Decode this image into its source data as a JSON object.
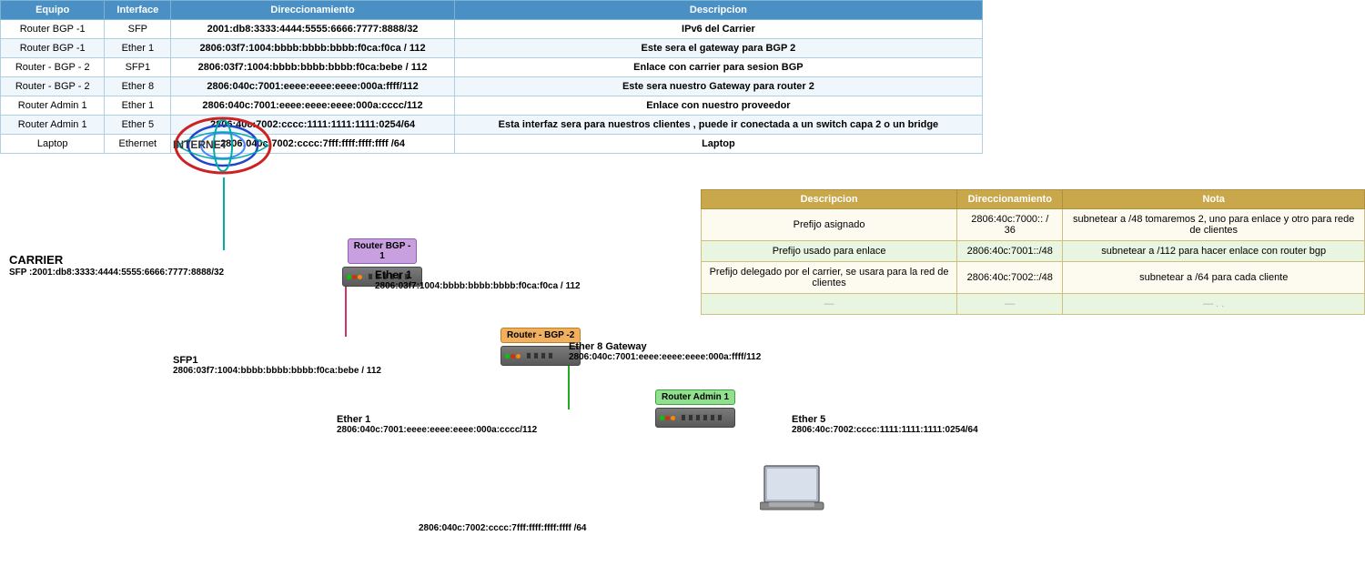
{
  "table": {
    "headers": [
      "Equipo",
      "Interface",
      "Direccionamiento",
      "Descripcion"
    ],
    "rows": [
      {
        "equipo": "Router BGP -1",
        "interface": "SFP",
        "direccionamiento": "2001:db8:3333:4444:5555:6666:7777:8888/32",
        "descripcion": "IPv6 del Carrier"
      },
      {
        "equipo": "Router BGP -1",
        "interface": "Ether 1",
        "direccionamiento": "2806:03f7:1004:bbbb:bbbb:bbbb:f0ca:f0ca / 112",
        "descripcion": "Este sera el gateway para BGP 2"
      },
      {
        "equipo": "Router - BGP - 2",
        "interface": "SFP1",
        "direccionamiento": "2806:03f7:1004:bbbb:bbbb:bbbb:f0ca:bebe / 112",
        "descripcion": "Enlace con carrier para sesion BGP"
      },
      {
        "equipo": "Router - BGP - 2",
        "interface": "Ether 8",
        "direccionamiento": "2806:040c:7001:eeee:eeee:eeee:000a:ffff/112",
        "descripcion": "Este sera nuestro Gateway para router 2"
      },
      {
        "equipo": "Router Admin 1",
        "interface": "Ether 1",
        "direccionamiento": "2806:040c:7001:eeee:eeee:eeee:000a:cccc/112",
        "descripcion": "Enlace con nuestro proveedor"
      },
      {
        "equipo": "Router Admin 1",
        "interface": "Ether 5",
        "direccionamiento": "2806:40c:7002:cccc:1111:1111:1111:0254/64",
        "descripcion": "Esta interfaz sera para nuestros clientes , puede ir conectada a un switch capa 2 o un bridge"
      },
      {
        "equipo": "Laptop",
        "interface": "Ethernet",
        "direccionamiento": "2806:040c:7002:cccc:7fff:ffff:ffff:ffff /64",
        "descripcion": "Laptop"
      }
    ]
  },
  "second_table": {
    "headers": [
      "Descripcion",
      "Direccionamiento",
      "Nota"
    ],
    "rows": [
      {
        "descripcion": "Prefijo asignado",
        "direccionamiento": "2806:40c:7000:: / 36",
        "nota": "subnetear a /48  tomaremos 2, uno para enlace y otro para rede de clientes"
      },
      {
        "descripcion": "Prefijo usado para enlace",
        "direccionamiento": "2806:40c:7001::/48",
        "nota": "subnetear a /112 para hacer enlace con router bgp"
      },
      {
        "descripcion": "Prefijo delegado por el carrier, se usara para la red de clientes",
        "direccionamiento": "2806:40c:7002::/48",
        "nota": "subnetear a /64 para cada cliente"
      },
      {
        "descripcion": "—",
        "direccionamiento": "—",
        "nota": "— . ."
      }
    ]
  },
  "diagram": {
    "internet_label": "INTERNET",
    "carrier_label": "CARRIER",
    "carrier_sfp": "SFP :2001:db8:3333:4444:5555:6666:7777:8888/32",
    "router_bgp1_label": "Router BGP -\n1",
    "router_bgp2_label": "Router - BGP -2",
    "router_admin1_label": "Router Admin 1",
    "ether1_bgp1_iface": "Ether 1",
    "ether1_bgp1_addr": "2806:03f7:1004:bbbb:bbbb:bbbb:f0ca:f0ca / 112",
    "sfp1_bgp2_iface": "SFP1",
    "sfp1_bgp2_addr": "2806:03f7:1004:bbbb:bbbb:bbbb:f0ca:bebe / 112",
    "ether8_gw_iface": "Ether 8 Gateway",
    "ether8_gw_addr": "2806:040c:7001:eeee:eeee:eeee:000a:ffff/112",
    "ether1_admin_iface": "Ether 1",
    "ether1_admin_addr": "2806:040c:7001:eeee:eeee:eeee:000a:cccc/112",
    "ether5_admin_iface": "Ether 5",
    "ether5_admin_addr": "2806:40c:7002:cccc:1111:1111:1111:0254/64",
    "laptop_addr": "2806:040c:7002:cccc:7fff:ffff:ffff:ffff /64"
  }
}
